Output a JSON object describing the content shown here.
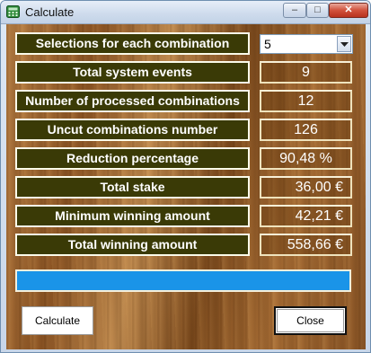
{
  "window": {
    "title": "Calculate",
    "controls": {
      "minimize": "–",
      "maximize": "□",
      "close": "✕"
    }
  },
  "fields": [
    {
      "label": "Selections for each combination",
      "value": "5",
      "kind": "select"
    },
    {
      "label": "Total system events",
      "value": "9",
      "align": "center"
    },
    {
      "label": "Number of processed combinations",
      "value": "12",
      "align": "center"
    },
    {
      "label": "Uncut combinations number",
      "value": "126",
      "align": "center"
    },
    {
      "label": "Reduction percentage",
      "value": "90,48 %",
      "align": "center"
    },
    {
      "label": "Total stake",
      "value": "36,00 €",
      "align": "right"
    },
    {
      "label": "Minimum winning amount",
      "value": "42,21 €",
      "align": "right"
    },
    {
      "label": "Total winning amount",
      "value": "558,66 €",
      "align": "right"
    }
  ],
  "progress": {
    "value": 1.0,
    "color": "#1a94e8"
  },
  "buttons": {
    "calculate": "Calculate",
    "close": "Close"
  },
  "icons": {
    "app": "calculator-icon",
    "dropdown": "chevron-down-icon"
  }
}
